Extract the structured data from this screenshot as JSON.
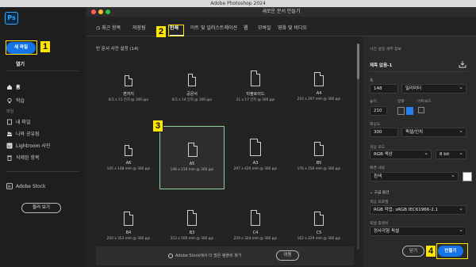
{
  "app_title": "Adobe Photoshop 2024",
  "dialog_title": "새로운 문서 만들기",
  "sidebar": {
    "logo": "Ps",
    "new_file": "새 파일",
    "open": "열기",
    "home": "홈",
    "learn": "학습",
    "files_section": "파일",
    "my_files": "내 파일",
    "shared": "나와 공유됨",
    "lightroom": "Lightroom 사진",
    "deleted": "삭제된 항목",
    "adobe_stock": "Adobe Stock",
    "browse": "둘러 보기"
  },
  "tabs": [
    {
      "label": "최근 항목"
    },
    {
      "label": "저장됨"
    },
    {
      "label": "인쇄"
    },
    {
      "label": "아트 및 일러스트레이션"
    },
    {
      "label": "웹"
    },
    {
      "label": "모바일"
    },
    {
      "label": "영화 및 비디오"
    }
  ],
  "preset_header": "빈 문서 사전 설정 (14)",
  "presets": [
    {
      "name": "편지지",
      "dim": "8.5 x 11 인치 @ 300 ppi"
    },
    {
      "name": "공문서",
      "dim": "8.5 x 14 인치 @ 300 ppi"
    },
    {
      "name": "타블로이드",
      "dim": "11 x 17 인치 @ 300 ppi"
    },
    {
      "name": "A4",
      "dim": "210 x 297 mm @ 300 ppi"
    },
    {
      "name": "A6",
      "dim": "105 x 148 mm @ 300 ppi"
    },
    {
      "name": "A5",
      "dim": "148 x 210 mm @ 300 ppi"
    },
    {
      "name": "A3",
      "dim": "297 x 420 mm @ 300 ppi"
    },
    {
      "name": "B5",
      "dim": "176 x 250 mm @ 300 ppi"
    },
    {
      "name": "B4",
      "dim": "250 x 353 mm @ 300 ppi"
    },
    {
      "name": "B3",
      "dim": "353 x 500 mm @ 300 ppi"
    },
    {
      "name": "C4",
      "dim": "229 x 324 mm @ 300 ppi"
    },
    {
      "name": "C5",
      "dim": "162 x 229 mm @ 300 ppi"
    }
  ],
  "search_placeholder": "Adobe Stock에서 더 많은 템플릿 찾기",
  "go_label": "이동",
  "details": {
    "header": "사전 설정 세부 정보",
    "doc_name": "제목 없음-1",
    "width_label": "폭",
    "width_value": "148",
    "unit": "밀리미터",
    "height_label": "높이",
    "height_value": "210",
    "orientation_label": "방향",
    "artboard_label": "아트보드",
    "resolution_label": "해상도",
    "resolution_value": "300",
    "resolution_unit": "픽셀/인치",
    "color_mode_label": "색상 모드",
    "color_mode": "RGB 색상",
    "bit_depth": "8 bit",
    "bg_label": "배경 내용",
    "bg_value": "흰색",
    "advanced": "고급 옵션",
    "profile_label": "색상 프로필",
    "profile_value": "RGB 작업: sRGB IEC61966-2.1",
    "aspect_label": "픽셀 종횡비",
    "aspect_value": "정사각형 픽셀"
  },
  "close_label": "닫기",
  "create_label": "만들기",
  "callouts": [
    "1",
    "2",
    "3",
    "4"
  ]
}
